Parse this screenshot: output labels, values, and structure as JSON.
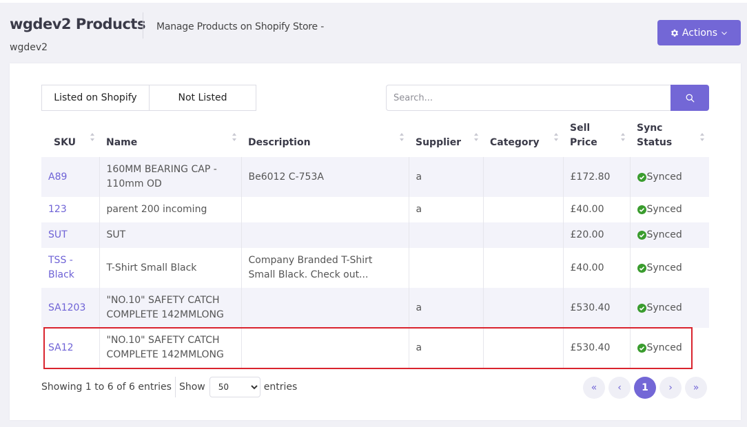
{
  "header": {
    "title": "wgdev2 Products",
    "subtitle": "Manage Products on Shopify Store -",
    "store": "wgdev2",
    "actions_label": "Actions"
  },
  "tabs": [
    {
      "label": "Listed on Shopify"
    },
    {
      "label": "Not Listed"
    }
  ],
  "search": {
    "placeholder": "Search...",
    "value": ""
  },
  "table": {
    "columns": [
      "SKU",
      "Name",
      "Description",
      "Supplier",
      "Category",
      "Sell Price",
      "Sync Status"
    ],
    "rows": [
      {
        "sku": "A89",
        "name": "160MM BEARING CAP - 110mm OD",
        "description": "Be6012 C-753A",
        "supplier": "a",
        "category": "",
        "price": "£172.80",
        "status": "Synced"
      },
      {
        "sku": "123",
        "name": "parent 200 incoming",
        "description": "",
        "supplier": "a",
        "category": "",
        "price": "£40.00",
        "status": "Synced"
      },
      {
        "sku": "SUT",
        "name": "SUT",
        "description": "",
        "supplier": "",
        "category": "",
        "price": "£20.00",
        "status": "Synced"
      },
      {
        "sku": "TSS - Black",
        "name": "T-Shirt Small Black",
        "description": "Company Branded T-Shirt Small Black. Check out...",
        "supplier": "",
        "category": "",
        "price": "£40.00",
        "status": "Synced"
      },
      {
        "sku": "SA1203",
        "name": "\"NO.10\" SAFETY CATCH COMPLETE 142MMLONG",
        "description": "",
        "supplier": "a",
        "category": "",
        "price": "£530.40",
        "status": "Synced"
      },
      {
        "sku": "SA12",
        "name": "\"NO.10\" SAFETY CATCH COMPLETE 142MMLONG",
        "description": "",
        "supplier": "a",
        "category": "",
        "price": "£530.40",
        "status": "Synced"
      }
    ]
  },
  "footer": {
    "info": "Showing 1 to 6 of 6 entries",
    "show_label": "Show",
    "page_size": "50",
    "entries_label": "entries"
  },
  "pagination": {
    "first": "«",
    "prev": "‹",
    "current": "1",
    "next": "›",
    "last": "»"
  },
  "colors": {
    "accent": "#7367d6",
    "synced": "#3a9c2e",
    "highlight": "#d9232d"
  },
  "icons": {
    "actions": "gear-icon",
    "actions_caret": "chevron-down-icon",
    "search": "search-icon",
    "status": "check-circle-icon",
    "sort": "sort-icon"
  }
}
